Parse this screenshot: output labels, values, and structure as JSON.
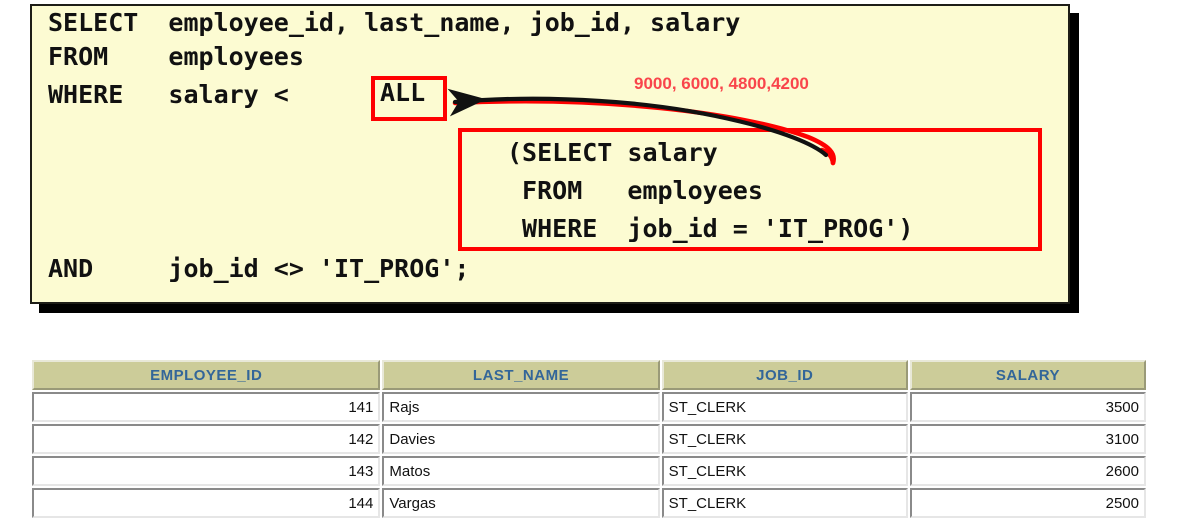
{
  "sql": {
    "line1": "SELECT  employee_id, last_name, job_id, salary",
    "line2": "FROM    employees",
    "line3": "WHERE   salary <",
    "highlight_keyword": "ALL",
    "line_and": "AND     job_id <> 'IT_PROG';",
    "subquery": {
      "line1": "(SELECT salary",
      "line2": " FROM   employees",
      "line3": " WHERE  job_id = 'IT_PROG')"
    }
  },
  "annotation": {
    "values_label": "9000, 6000, 4800,4200",
    "color": "#f9454b",
    "arrow_name": "curved-arrow-subquery-to-all"
  },
  "results": {
    "columns": [
      "EMPLOYEE_ID",
      "LAST_NAME",
      "JOB_ID",
      "SALARY"
    ],
    "rows": [
      {
        "employee_id": "141",
        "last_name": "Rajs",
        "job_id": "ST_CLERK",
        "salary": "3500"
      },
      {
        "employee_id": "142",
        "last_name": "Davies",
        "job_id": "ST_CLERK",
        "salary": "3100"
      },
      {
        "employee_id": "143",
        "last_name": "Matos",
        "job_id": "ST_CLERK",
        "salary": "2600"
      },
      {
        "employee_id": "144",
        "last_name": "Vargas",
        "job_id": "ST_CLERK",
        "salary": "2500"
      }
    ]
  },
  "colors": {
    "code_background": "#fcfbd2",
    "code_border": "#1d1d17",
    "highlight_box": "#fe0000",
    "table_header_bg": "#cccc99",
    "table_header_text": "#336699"
  }
}
